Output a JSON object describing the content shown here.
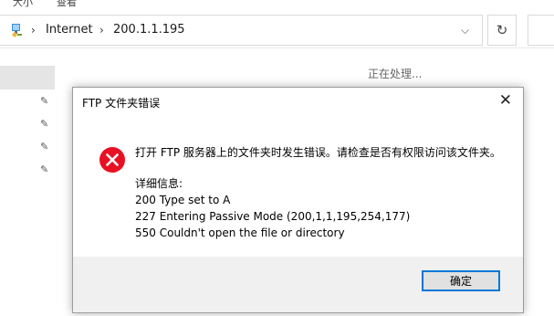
{
  "explorer": {
    "top_text_1": "大小",
    "top_text_2": "查看",
    "breadcrumb": [
      "Internet",
      "200.1.1.195"
    ],
    "status_text": "正在处理..."
  },
  "dialog": {
    "title": "FTP 文件夹错误",
    "message": "打开 FTP 服务器上的文件夹时发生错误。请检查是否有权限访问该文件夹。",
    "details_label": "详细信息:",
    "details_lines": [
      "200 Type set to A",
      "227 Entering Passive Mode (200,1,1,195,254,177)",
      "550 Couldn't open the file or directory"
    ],
    "ok_label": "确定"
  },
  "icons": {
    "error": "error-icon",
    "pin": "pin-icon",
    "location": "network-location-icon"
  },
  "colors": {
    "error_red": "#e81123",
    "accent": "#0078d7"
  }
}
